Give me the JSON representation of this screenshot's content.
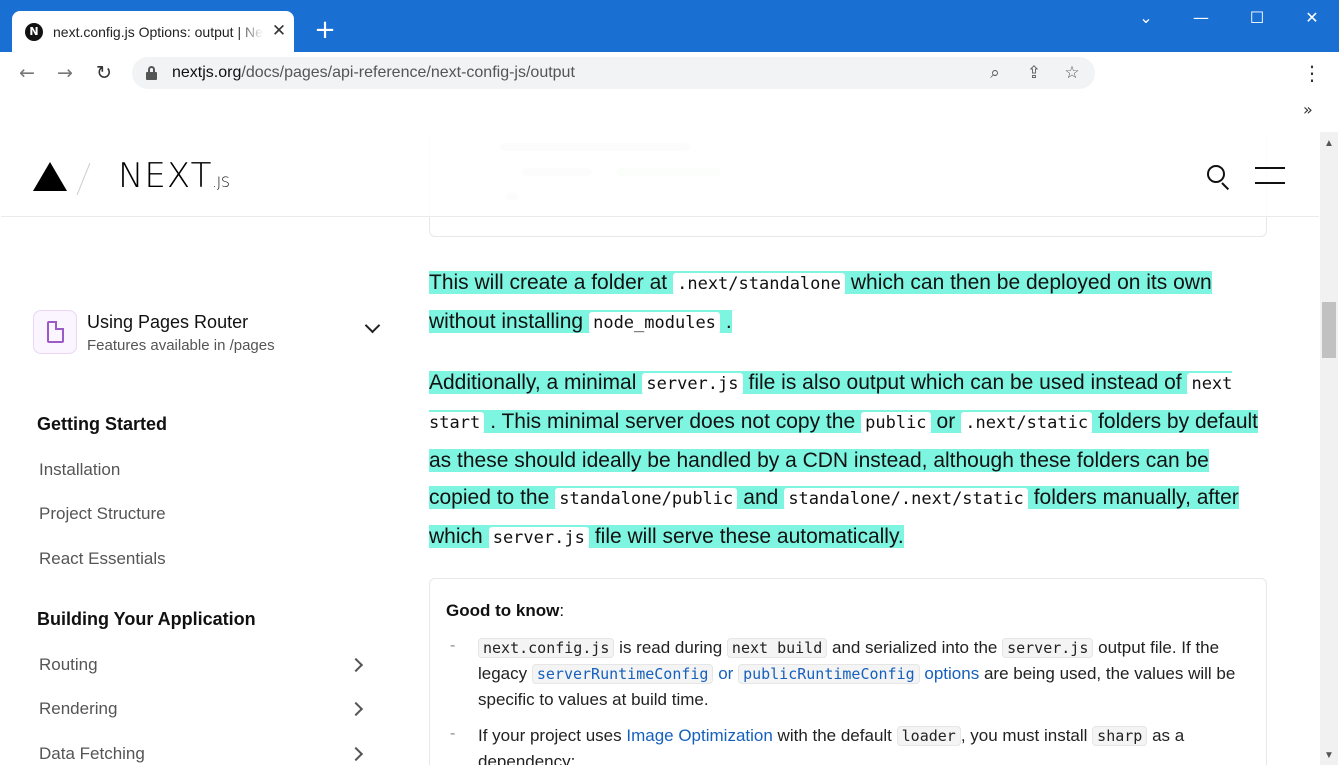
{
  "browser": {
    "tab_title": "next.config.js Options: output | Next.js",
    "favicon_letter": "N",
    "close_glyph": "✕",
    "newtab_glyph": "+",
    "url_host": "nextjs.org",
    "url_path": "/docs/pages/api-reference/next-config-js/output",
    "controls": {
      "tabsearch": "⌄",
      "minimize": "—",
      "maximize": "☐",
      "close": "✕"
    },
    "nav": {
      "back": "←",
      "forward": "→",
      "reload": "↻"
    },
    "omnibox_icons": {
      "zoom": "⌕",
      "share": "⇪",
      "bookmark": "☆"
    },
    "menu_glyph": "⋮",
    "bookmarks_more": "»"
  },
  "header": {
    "logo_text": "NEXT",
    "logo_suffix": ".JS"
  },
  "sidebar": {
    "router": {
      "title": "Using Pages Router",
      "subtitle": "Features available in /pages"
    },
    "sections": [
      {
        "heading": "Getting Started",
        "items": [
          "Installation",
          "Project Structure",
          "React Essentials"
        ]
      },
      {
        "heading": "Building Your Application",
        "items": [
          "Routing",
          "Rendering",
          "Data Fetching"
        ]
      }
    ]
  },
  "content": {
    "p1": {
      "a": "This will create a folder at",
      "code1": ".next/standalone",
      "b": "which can then be deployed on its own without installing",
      "code2": "node_modules",
      "c": "."
    },
    "p2": {
      "a": "Additionally, a minimal",
      "code1": "server.js",
      "b": "file is also output which can be used instead of",
      "code2": "next start",
      "c": ". This minimal server does not copy the",
      "code3": "public",
      "d": "or",
      "code4": ".next/static",
      "e": "folders by default as these should ideally be handled by a CDN instead, although these folders can be copied to the",
      "code5": "standalone/public",
      "f": "and",
      "code6": "standalone/.next/static",
      "g": "folders manually, after which",
      "code7": "server.js",
      "h": "file will serve these automatically."
    },
    "callout": {
      "title": "Good to know",
      "colon": ":",
      "dash": "-",
      "b1": {
        "code1": "next.config.js",
        "a": "is read during",
        "code2": "next build",
        "b": "and serialized into the",
        "code3": "server.js",
        "c": "output file. If the legacy",
        "link1": "serverRuntimeConfig",
        "d": "or",
        "link2": "publicRuntimeConfig",
        "e": "options",
        "f": "are being used, the values will be specific to values at build time."
      },
      "b2": {
        "a": "If your project uses",
        "link": "Image Optimization",
        "b": "with the default",
        "code1": "loader",
        "c": ", you must install",
        "code2": "sharp",
        "d": "as a dependency:"
      }
    }
  }
}
